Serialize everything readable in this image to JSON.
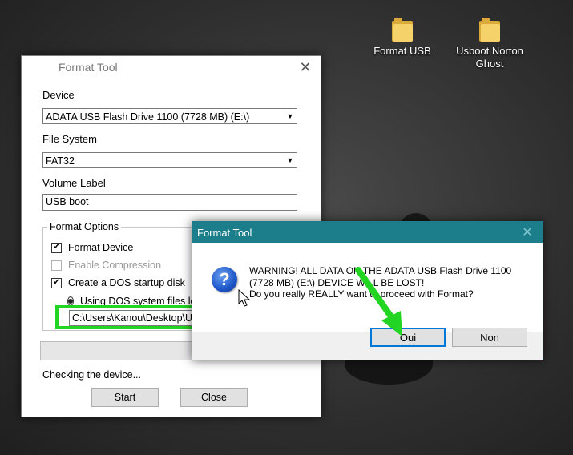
{
  "desktop": {
    "icons": [
      {
        "label": "Format USB"
      },
      {
        "label": "Usboot Norton Ghost"
      }
    ]
  },
  "main_window": {
    "title": "Format Tool",
    "device_label": "Device",
    "device_value": "ADATA USB Flash Drive 1100 (7728 MB) (E:\\)",
    "filesystem_label": "File System",
    "filesystem_value": "FAT32",
    "volume_label_label": "Volume Label",
    "volume_label_value": "USB boot",
    "format_options_label": "Format Options",
    "format_device_label": "Format Device",
    "enable_compression_label": "Enable Compression",
    "dos_startup_label": "Create a DOS startup disk",
    "using_dos_files_label": "Using DOS system files loc",
    "dos_path_value": "C:\\Users\\Kanou\\Desktop\\U",
    "status_text": "Checking the device...",
    "start_label": "Start",
    "close_label": "Close"
  },
  "dialog": {
    "title": "Format Tool",
    "message_line1": "WARNING! ALL DATA ON THE ADATA USB Flash Drive 1100",
    "message_line2": "(7728 MB) (E:\\) DEVICE WILL BE LOST!",
    "message_line3": "Do you really REALLY want to proceed with Format?",
    "yes_label": "Oui",
    "no_label": "Non"
  },
  "colors": {
    "dialog_title_bar": "#1b7e8a",
    "highlight_green": "#22d522",
    "default_button_border": "#0078d7"
  }
}
